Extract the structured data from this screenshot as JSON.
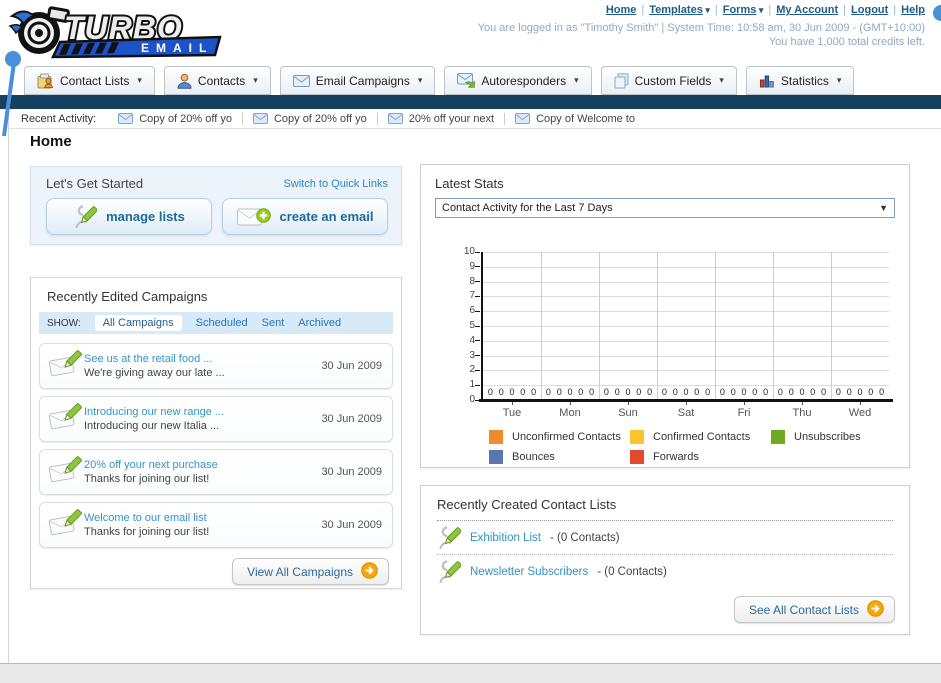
{
  "header": {
    "logo": {
      "title": "TURBO",
      "subtitle": "EMAIL"
    },
    "nav_links": [
      {
        "label": "Home",
        "dropdown": false
      },
      {
        "label": "Templates",
        "dropdown": true
      },
      {
        "label": "Forms",
        "dropdown": true
      },
      {
        "label": "My Account",
        "dropdown": false
      },
      {
        "label": "Logout",
        "dropdown": false
      },
      {
        "label": "Help",
        "dropdown": false
      }
    ],
    "login_info": "You are logged in as \"Timothy Smith\" | System Time: 10:58 am, 30 Jun 2009 - (GMT+10:00)",
    "credits_info": "You have 1,000 total credits left."
  },
  "tabs": [
    {
      "label": "Contact Lists",
      "icon": "contact-lists-icon"
    },
    {
      "label": "Contacts",
      "icon": "contacts-icon"
    },
    {
      "label": "Email Campaigns",
      "icon": "email-campaigns-icon"
    },
    {
      "label": "Autoresponders",
      "icon": "autoresponders-icon"
    },
    {
      "label": "Custom Fields",
      "icon": "custom-fields-icon"
    },
    {
      "label": "Statistics",
      "icon": "statistics-icon"
    }
  ],
  "recent_activity": {
    "label": "Recent Activity:",
    "items": [
      "Copy of 20% off yo",
      "Copy of 20% off yo",
      "20% off your next",
      "Copy of Welcome to"
    ]
  },
  "main": {
    "page_title": "Home",
    "get_started": {
      "title": "Let's Get Started",
      "switch_link": "Switch to Quick Links",
      "buttons": [
        {
          "label": "manage lists",
          "icon": "person-pencil-icon"
        },
        {
          "label": "create an email",
          "icon": "envelope-plus-icon"
        }
      ]
    },
    "campaigns": {
      "title": "Recently Edited Campaigns",
      "show_label": "SHOW:",
      "filters": [
        "All Campaigns",
        "Scheduled",
        "Sent",
        "Archived"
      ],
      "active_filter": "All Campaigns",
      "items": [
        {
          "title": "See us at the retail food ...",
          "subtitle": "We're giving away our late ...",
          "date": "30 Jun 2009"
        },
        {
          "title": "Introducing our new range ...",
          "subtitle": "Introducing our new Italia ...",
          "date": "30 Jun 2009"
        },
        {
          "title": "20% off your next purchase",
          "subtitle": "Thanks for joining our list!",
          "date": "30 Jun 2009"
        },
        {
          "title": "Welcome to our email list",
          "subtitle": "Thanks for joining our list!",
          "date": "30 Jun 2009"
        }
      ],
      "view_all_label": "View All Campaigns"
    },
    "stats": {
      "title": "Latest Stats",
      "dropdown_value": "Contact Activity for the Last 7 Days"
    },
    "contact_lists": {
      "title": "Recently Created Contact Lists",
      "items": [
        {
          "name": "Exhibition List",
          "separator": "-",
          "count": "(0 Contacts)"
        },
        {
          "name": "Newsletter Subscribers",
          "separator": "-",
          "count": "(0 Contacts)"
        }
      ],
      "see_all_label": "See All Contact Lists"
    }
  },
  "chart_data": {
    "type": "bar",
    "title": "Contact Activity for the Last 7 Days",
    "categories": [
      "Tue",
      "Mon",
      "Sun",
      "Sat",
      "Fri",
      "Thu",
      "Wed"
    ],
    "series": [
      {
        "name": "Unconfirmed Contacts",
        "color": "#f1892d",
        "values": [
          0,
          0,
          0,
          0,
          0,
          0,
          0
        ]
      },
      {
        "name": "Confirmed Contacts",
        "color": "#fdc32e",
        "values": [
          0,
          0,
          0,
          0,
          0,
          0,
          0
        ]
      },
      {
        "name": "Unsubscribes",
        "color": "#71a823",
        "values": [
          0,
          0,
          0,
          0,
          0,
          0,
          0
        ]
      },
      {
        "name": "Bounces",
        "color": "#5b76b0",
        "values": [
          0,
          0,
          0,
          0,
          0,
          0,
          0
        ]
      },
      {
        "name": "Forwards",
        "color": "#e2492f",
        "values": [
          0,
          0,
          0,
          0,
          0,
          0,
          0
        ]
      }
    ],
    "xlabel": "",
    "ylabel": "",
    "ylim": [
      0,
      10
    ],
    "yticks": [
      0,
      1,
      2,
      3,
      4,
      5,
      6,
      7,
      8,
      9,
      10
    ],
    "grid": true,
    "legend_position": "bottom",
    "value_labels_shown": true
  }
}
